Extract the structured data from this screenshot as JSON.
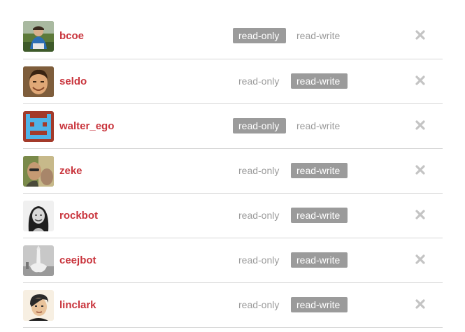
{
  "colors": {
    "username": "#c9353d",
    "badge_bg": "#9b9b9b",
    "badge_text": "#ffffff",
    "inactive_text": "#9b9b9b",
    "divider": "#d8d8d8"
  },
  "labels": {
    "read_only": "read-only",
    "read_write": "read-write"
  },
  "collaborators": [
    {
      "name": "bcoe",
      "permission": "read-only",
      "avatar": "photo-outdoor"
    },
    {
      "name": "seldo",
      "permission": "read-write",
      "avatar": "photo-face"
    },
    {
      "name": "walter_ego",
      "permission": "read-only",
      "avatar": "pixel-invader"
    },
    {
      "name": "zeke",
      "permission": "read-write",
      "avatar": "photo-selfie"
    },
    {
      "name": "rockbot",
      "permission": "read-write",
      "avatar": "photo-bw-portrait"
    },
    {
      "name": "ceejbot",
      "permission": "read-write",
      "avatar": "photo-rocket"
    },
    {
      "name": "linclark",
      "permission": "read-write",
      "avatar": "illustrated-face"
    }
  ],
  "remove_icon": "close-x-icon"
}
